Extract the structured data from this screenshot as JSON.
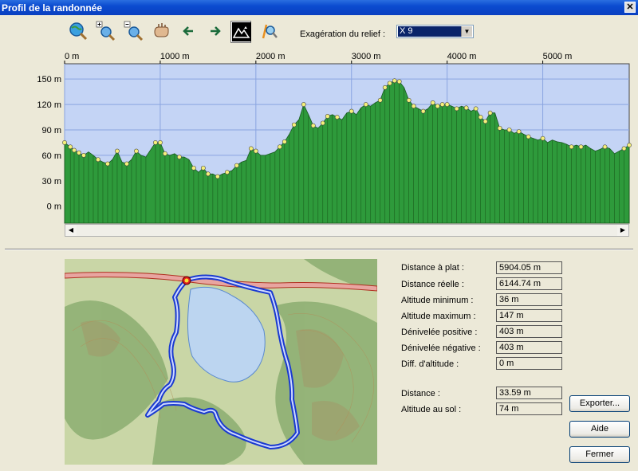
{
  "window": {
    "title": "Profil de la randonnée",
    "close_glyph": "✕"
  },
  "toolbar": {
    "tools": [
      {
        "name": "zoom-globe-icon",
        "x": 85
      },
      {
        "name": "zoom-in-icon",
        "x": 120
      },
      {
        "name": "zoom-out-icon",
        "x": 155
      },
      {
        "name": "hand-pan-icon",
        "x": 190
      },
      {
        "name": "arrow-left-icon",
        "x": 224
      },
      {
        "name": "arrow-right-icon",
        "x": 256
      },
      {
        "name": "relief-profile-icon",
        "x": 289,
        "active": true
      },
      {
        "name": "magnify-path-icon",
        "x": 324
      }
    ],
    "exaggeration_label": "Exagération du relief :",
    "exaggeration_value": "X 9"
  },
  "chart_data": {
    "type": "area",
    "x_label_ticks": [
      "0 m",
      "1000 m",
      "2000 m",
      "3000 m",
      "4000 m",
      "5000 m"
    ],
    "x_tick_values": [
      0,
      1000,
      2000,
      3000,
      4000,
      5000
    ],
    "y_tick_labels": [
      "150 m",
      "120 m",
      "90 m",
      "60 m",
      "30 m",
      "0 m"
    ],
    "y_tick_values": [
      150,
      120,
      90,
      60,
      30,
      0
    ],
    "xlim": [
      0,
      5904
    ],
    "ylim": [
      -20,
      168
    ],
    "fill_color": "#2e9a3b",
    "sky_color": "#c4d4f5",
    "marker_color": "#f5f07a",
    "profile": [
      [
        0,
        75
      ],
      [
        60,
        70
      ],
      [
        100,
        66
      ],
      [
        150,
        63
      ],
      [
        200,
        60
      ],
      [
        250,
        64
      ],
      [
        300,
        60
      ],
      [
        350,
        55
      ],
      [
        400,
        52
      ],
      [
        450,
        50
      ],
      [
        500,
        55
      ],
      [
        550,
        65
      ],
      [
        600,
        52
      ],
      [
        650,
        50
      ],
      [
        700,
        55
      ],
      [
        750,
        65
      ],
      [
        800,
        60
      ],
      [
        850,
        58
      ],
      [
        950,
        75
      ],
      [
        1000,
        75
      ],
      [
        1050,
        62
      ],
      [
        1100,
        60
      ],
      [
        1150,
        62
      ],
      [
        1200,
        58
      ],
      [
        1250,
        58
      ],
      [
        1300,
        55
      ],
      [
        1350,
        45
      ],
      [
        1400,
        40
      ],
      [
        1450,
        45
      ],
      [
        1500,
        38
      ],
      [
        1550,
        38
      ],
      [
        1600,
        35
      ],
      [
        1650,
        38
      ],
      [
        1700,
        40
      ],
      [
        1750,
        42
      ],
      [
        1800,
        48
      ],
      [
        1850,
        52
      ],
      [
        1900,
        54
      ],
      [
        1950,
        68
      ],
      [
        2000,
        65
      ],
      [
        2050,
        60
      ],
      [
        2100,
        60
      ],
      [
        2150,
        62
      ],
      [
        2200,
        64
      ],
      [
        2250,
        70
      ],
      [
        2300,
        76
      ],
      [
        2350,
        85
      ],
      [
        2400,
        96
      ],
      [
        2450,
        102
      ],
      [
        2500,
        120
      ],
      [
        2550,
        108
      ],
      [
        2600,
        95
      ],
      [
        2650,
        92
      ],
      [
        2700,
        98
      ],
      [
        2750,
        106
      ],
      [
        2800,
        108
      ],
      [
        2850,
        105
      ],
      [
        2900,
        102
      ],
      [
        2950,
        110
      ],
      [
        3000,
        112
      ],
      [
        3050,
        108
      ],
      [
        3100,
        116
      ],
      [
        3150,
        120
      ],
      [
        3200,
        118
      ],
      [
        3250,
        122
      ],
      [
        3300,
        125
      ],
      [
        3350,
        140
      ],
      [
        3400,
        145
      ],
      [
        3450,
        148
      ],
      [
        3500,
        147
      ],
      [
        3550,
        140
      ],
      [
        3600,
        125
      ],
      [
        3650,
        118
      ],
      [
        3700,
        115
      ],
      [
        3750,
        112
      ],
      [
        3800,
        115
      ],
      [
        3850,
        122
      ],
      [
        3900,
        118
      ],
      [
        3950,
        120
      ],
      [
        4000,
        120
      ],
      [
        4050,
        118
      ],
      [
        4100,
        115
      ],
      [
        4150,
        118
      ],
      [
        4200,
        116
      ],
      [
        4250,
        112
      ],
      [
        4300,
        115
      ],
      [
        4350,
        105
      ],
      [
        4400,
        100
      ],
      [
        4450,
        110
      ],
      [
        4500,
        110
      ],
      [
        4550,
        92
      ],
      [
        4600,
        90
      ],
      [
        4650,
        90
      ],
      [
        4700,
        86
      ],
      [
        4750,
        88
      ],
      [
        4800,
        85
      ],
      [
        4850,
        82
      ],
      [
        4900,
        80
      ],
      [
        4950,
        78
      ],
      [
        5000,
        80
      ],
      [
        5050,
        75
      ],
      [
        5100,
        78
      ],
      [
        5150,
        76
      ],
      [
        5200,
        75
      ],
      [
        5250,
        73
      ],
      [
        5300,
        70
      ],
      [
        5350,
        72
      ],
      [
        5400,
        70
      ],
      [
        5450,
        72
      ],
      [
        5500,
        68
      ],
      [
        5550,
        65
      ],
      [
        5600,
        67
      ],
      [
        5650,
        70
      ],
      [
        5700,
        68
      ],
      [
        5750,
        62
      ],
      [
        5800,
        65
      ],
      [
        5850,
        68
      ],
      [
        5904,
        72
      ]
    ],
    "markers": [
      [
        0,
        75
      ],
      [
        60,
        70
      ],
      [
        100,
        66
      ],
      [
        150,
        63
      ],
      [
        200,
        60
      ],
      [
        350,
        55
      ],
      [
        450,
        50
      ],
      [
        550,
        65
      ],
      [
        650,
        50
      ],
      [
        750,
        65
      ],
      [
        950,
        75
      ],
      [
        1000,
        75
      ],
      [
        1050,
        62
      ],
      [
        1200,
        58
      ],
      [
        1350,
        45
      ],
      [
        1450,
        45
      ],
      [
        1500,
        38
      ],
      [
        1600,
        35
      ],
      [
        1700,
        40
      ],
      [
        1800,
        48
      ],
      [
        1950,
        68
      ],
      [
        2000,
        65
      ],
      [
        2250,
        70
      ],
      [
        2300,
        76
      ],
      [
        2400,
        96
      ],
      [
        2500,
        120
      ],
      [
        2600,
        95
      ],
      [
        2700,
        98
      ],
      [
        2750,
        106
      ],
      [
        2850,
        105
      ],
      [
        3000,
        112
      ],
      [
        3150,
        120
      ],
      [
        3300,
        125
      ],
      [
        3350,
        140
      ],
      [
        3400,
        145
      ],
      [
        3450,
        148
      ],
      [
        3500,
        147
      ],
      [
        3600,
        125
      ],
      [
        3650,
        118
      ],
      [
        3750,
        112
      ],
      [
        3850,
        122
      ],
      [
        3900,
        118
      ],
      [
        3950,
        120
      ],
      [
        4000,
        120
      ],
      [
        4100,
        115
      ],
      [
        4200,
        116
      ],
      [
        4300,
        115
      ],
      [
        4350,
        105
      ],
      [
        4400,
        100
      ],
      [
        4450,
        110
      ],
      [
        4550,
        92
      ],
      [
        4650,
        90
      ],
      [
        4750,
        88
      ],
      [
        4850,
        82
      ],
      [
        5000,
        80
      ],
      [
        5300,
        70
      ],
      [
        5400,
        70
      ],
      [
        5650,
        70
      ],
      [
        5850,
        68
      ],
      [
        5904,
        72
      ]
    ]
  },
  "map": {
    "land_color": "#c9d6a6",
    "forest_color": "#8fb074",
    "lake_color": "#bcd5f0",
    "route_color": "#3a4cf0"
  },
  "stats": {
    "distance_plat_label": "Distance à plat :",
    "distance_plat_value": "5904.05 m",
    "distance_reelle_label": "Distance réelle :",
    "distance_reelle_value": "6144.74 m",
    "alt_min_label": "Altitude minimum :",
    "alt_min_value": "36 m",
    "alt_max_label": "Altitude maximum :",
    "alt_max_value": "147 m",
    "den_pos_label": "Dénivelée positive :",
    "den_pos_value": "403 m",
    "den_neg_label": "Dénivelée négative :",
    "den_neg_value": "403 m",
    "diff_alt_label": "Diff. d'altitude :",
    "diff_alt_value": "0 m",
    "distance_label": "Distance :",
    "distance_value": "33.59 m",
    "alt_sol_label": "Altitude au sol :",
    "alt_sol_value": "74 m"
  },
  "buttons": {
    "export": "Exporter...",
    "help": "Aide",
    "close": "Fermer"
  }
}
